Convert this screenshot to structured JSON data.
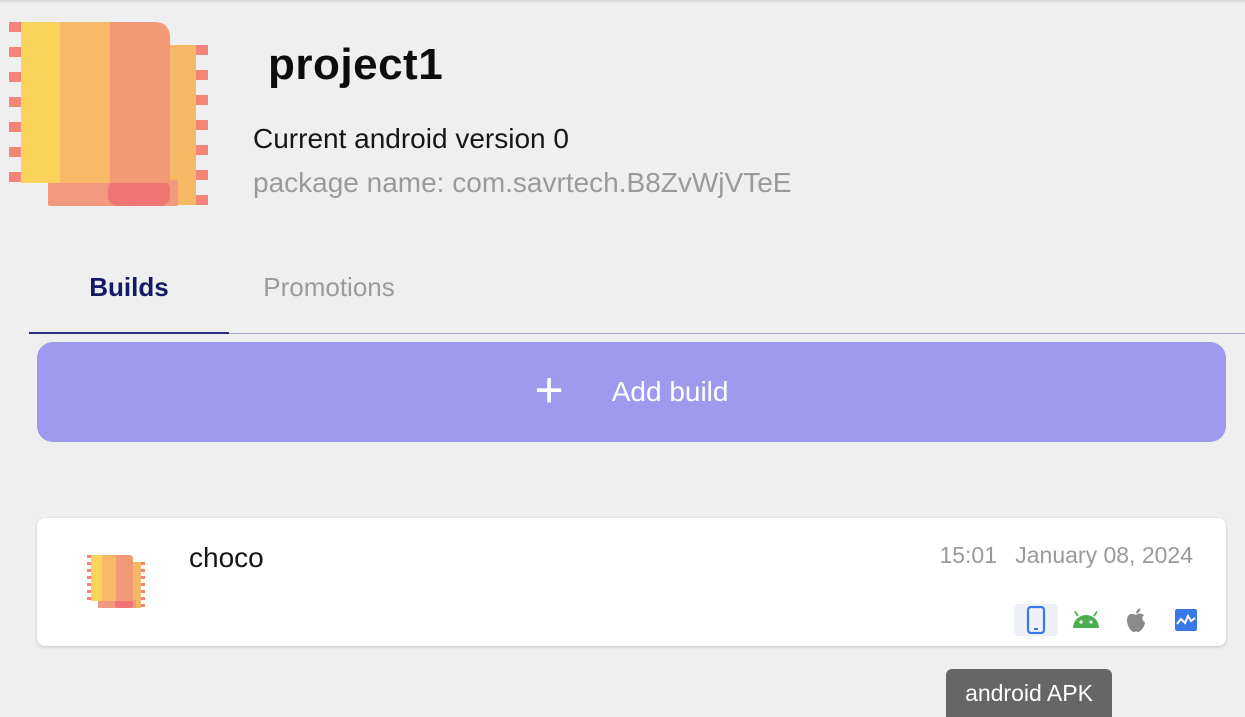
{
  "project": {
    "title": "project1",
    "version_text": "Current android version 0",
    "package_text": "package name: com.savrtech.B8ZvWjVTeE",
    "icon": "project-book-icon"
  },
  "tabs": [
    {
      "label": "Builds",
      "active": true
    },
    {
      "label": "Promotions",
      "active": false
    }
  ],
  "add_build": {
    "label": "Add build",
    "icon": "+"
  },
  "builds": [
    {
      "name": "choco",
      "time": "15:01",
      "date": "January 08, 2024",
      "platforms": [
        "phone-icon",
        "android-icon",
        "apple-icon",
        "web-icon"
      ]
    }
  ],
  "tooltip": {
    "text": "android APK"
  },
  "colors": {
    "accent": "#9f9af0",
    "tab_active": "#141a66",
    "android_green": "#4caf50",
    "apple_gray": "#8a8a8a",
    "blue": "#3b78e7"
  }
}
